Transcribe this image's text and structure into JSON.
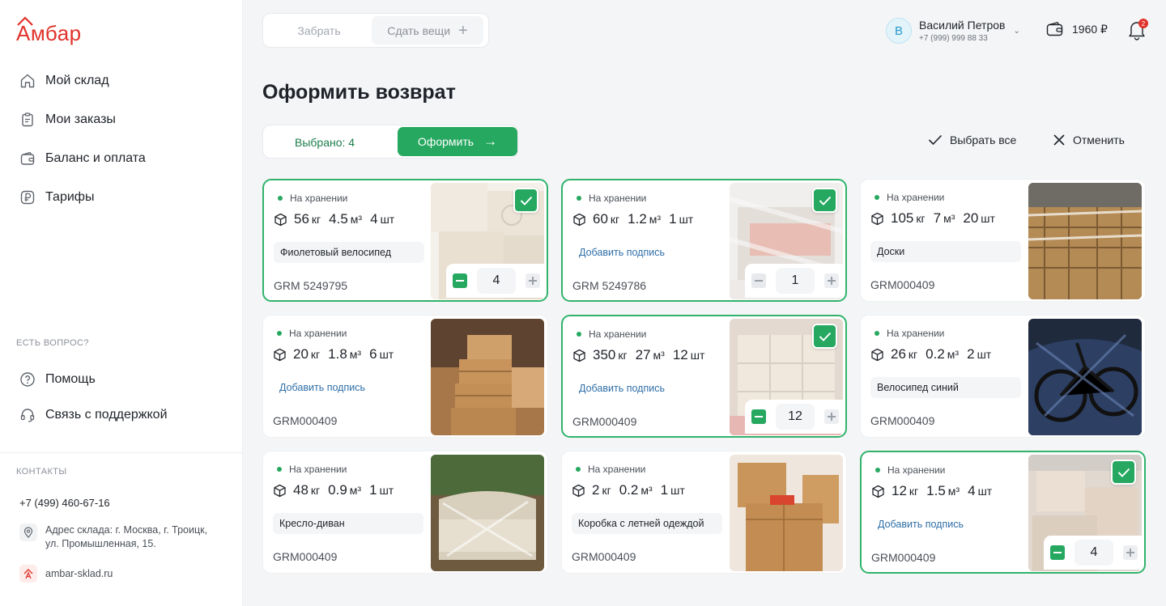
{
  "brand": {
    "name": "Амбар"
  },
  "nav": [
    {
      "label": "Мой склад",
      "icon": "home-icon"
    },
    {
      "label": "Мои заказы",
      "icon": "clipboard-icon"
    },
    {
      "label": "Баланс и оплата",
      "icon": "wallet-icon"
    },
    {
      "label": "Тарифы",
      "icon": "ruble-icon"
    }
  ],
  "help": {
    "title": "ЕСТЬ ВОПРОС?",
    "items": [
      {
        "label": "Помощь",
        "icon": "question-icon"
      },
      {
        "label": "Связь с поддержкой",
        "icon": "headset-icon"
      }
    ]
  },
  "contacts": {
    "title": "КОНТАКТЫ",
    "phone": "+7 (499) 460-67-16",
    "address": "Адрес склада: г. Москва,  г. Троицк, ул. Промышленная, 15.",
    "site": "ambar-sklad.ru"
  },
  "switcher": {
    "take": "Забрать",
    "give": "Сдать вещи"
  },
  "user": {
    "initial": "В",
    "name": "Василий Петров",
    "phone": "+7 (999) 999 88 33"
  },
  "balance": "1960 ₽",
  "notifications": "2",
  "page_title": "Оформить возврат",
  "toolbar": {
    "selected": "Выбрано: 4",
    "submit": "Оформить",
    "select_all": "Выбрать все",
    "cancel": "Отменить"
  },
  "units": {
    "kg": "кг",
    "m3": "м³",
    "pcs": "шт"
  },
  "cards": [
    {
      "status": "На хранении",
      "weight": "56",
      "volume": "4.5",
      "count": "4",
      "label": "Фиолетовый велосипед",
      "label_is_add": false,
      "code": "GRM 5249795",
      "selected": true,
      "qty": "4",
      "photo": "boxes-pale"
    },
    {
      "status": "На хранении",
      "weight": "60",
      "volume": "1.2",
      "count": "1",
      "label": "Добавить подпись",
      "label_is_add": true,
      "code": "GRM 5249786",
      "selected": true,
      "qty": "1",
      "photo": "wrapped-pallet"
    },
    {
      "status": "На хранении",
      "weight": "105",
      "volume": "7",
      "count": "20",
      "label": "Доски",
      "label_is_add": false,
      "code": "GRM000409",
      "selected": false,
      "qty": "",
      "photo": "warehouse-boxes"
    },
    {
      "status": "На хранении",
      "weight": "20",
      "volume": "1.8",
      "count": "6",
      "label": "Добавить подпись",
      "label_is_add": true,
      "code": "GRM000409",
      "selected": false,
      "qty": "",
      "photo": "box-stack"
    },
    {
      "status": "На хранении",
      "weight": "350",
      "volume": "27",
      "count": "12",
      "label": "Добавить подпись",
      "label_is_add": true,
      "code": "GRM000409",
      "selected": true,
      "qty": "12",
      "photo": "pallet-boxes"
    },
    {
      "status": "На хранении",
      "weight": "26",
      "volume": "0.2",
      "count": "2",
      "label": "Велосипед синий",
      "label_is_add": false,
      "code": "GRM000409",
      "selected": false,
      "qty": "",
      "photo": "wrapped-bike"
    },
    {
      "status": "На хранении",
      "weight": "48",
      "volume": "0.9",
      "count": "1",
      "label": "Кресло-диван",
      "label_is_add": false,
      "code": "GRM000409",
      "selected": false,
      "qty": "",
      "photo": "wrapped-sofa"
    },
    {
      "status": "На хранении",
      "weight": "2",
      "volume": "0.2",
      "count": "1",
      "label": "Коробка с летней одеждой",
      "label_is_add": false,
      "code": "GRM000409",
      "selected": false,
      "qty": "",
      "photo": "cardboard-boxes"
    },
    {
      "status": "На хранении",
      "weight": "12",
      "volume": "1.5",
      "count": "4",
      "label": "Добавить подпись",
      "label_is_add": true,
      "code": "GRM000409",
      "selected": true,
      "qty": "4",
      "photo": "moving-boxes"
    }
  ]
}
